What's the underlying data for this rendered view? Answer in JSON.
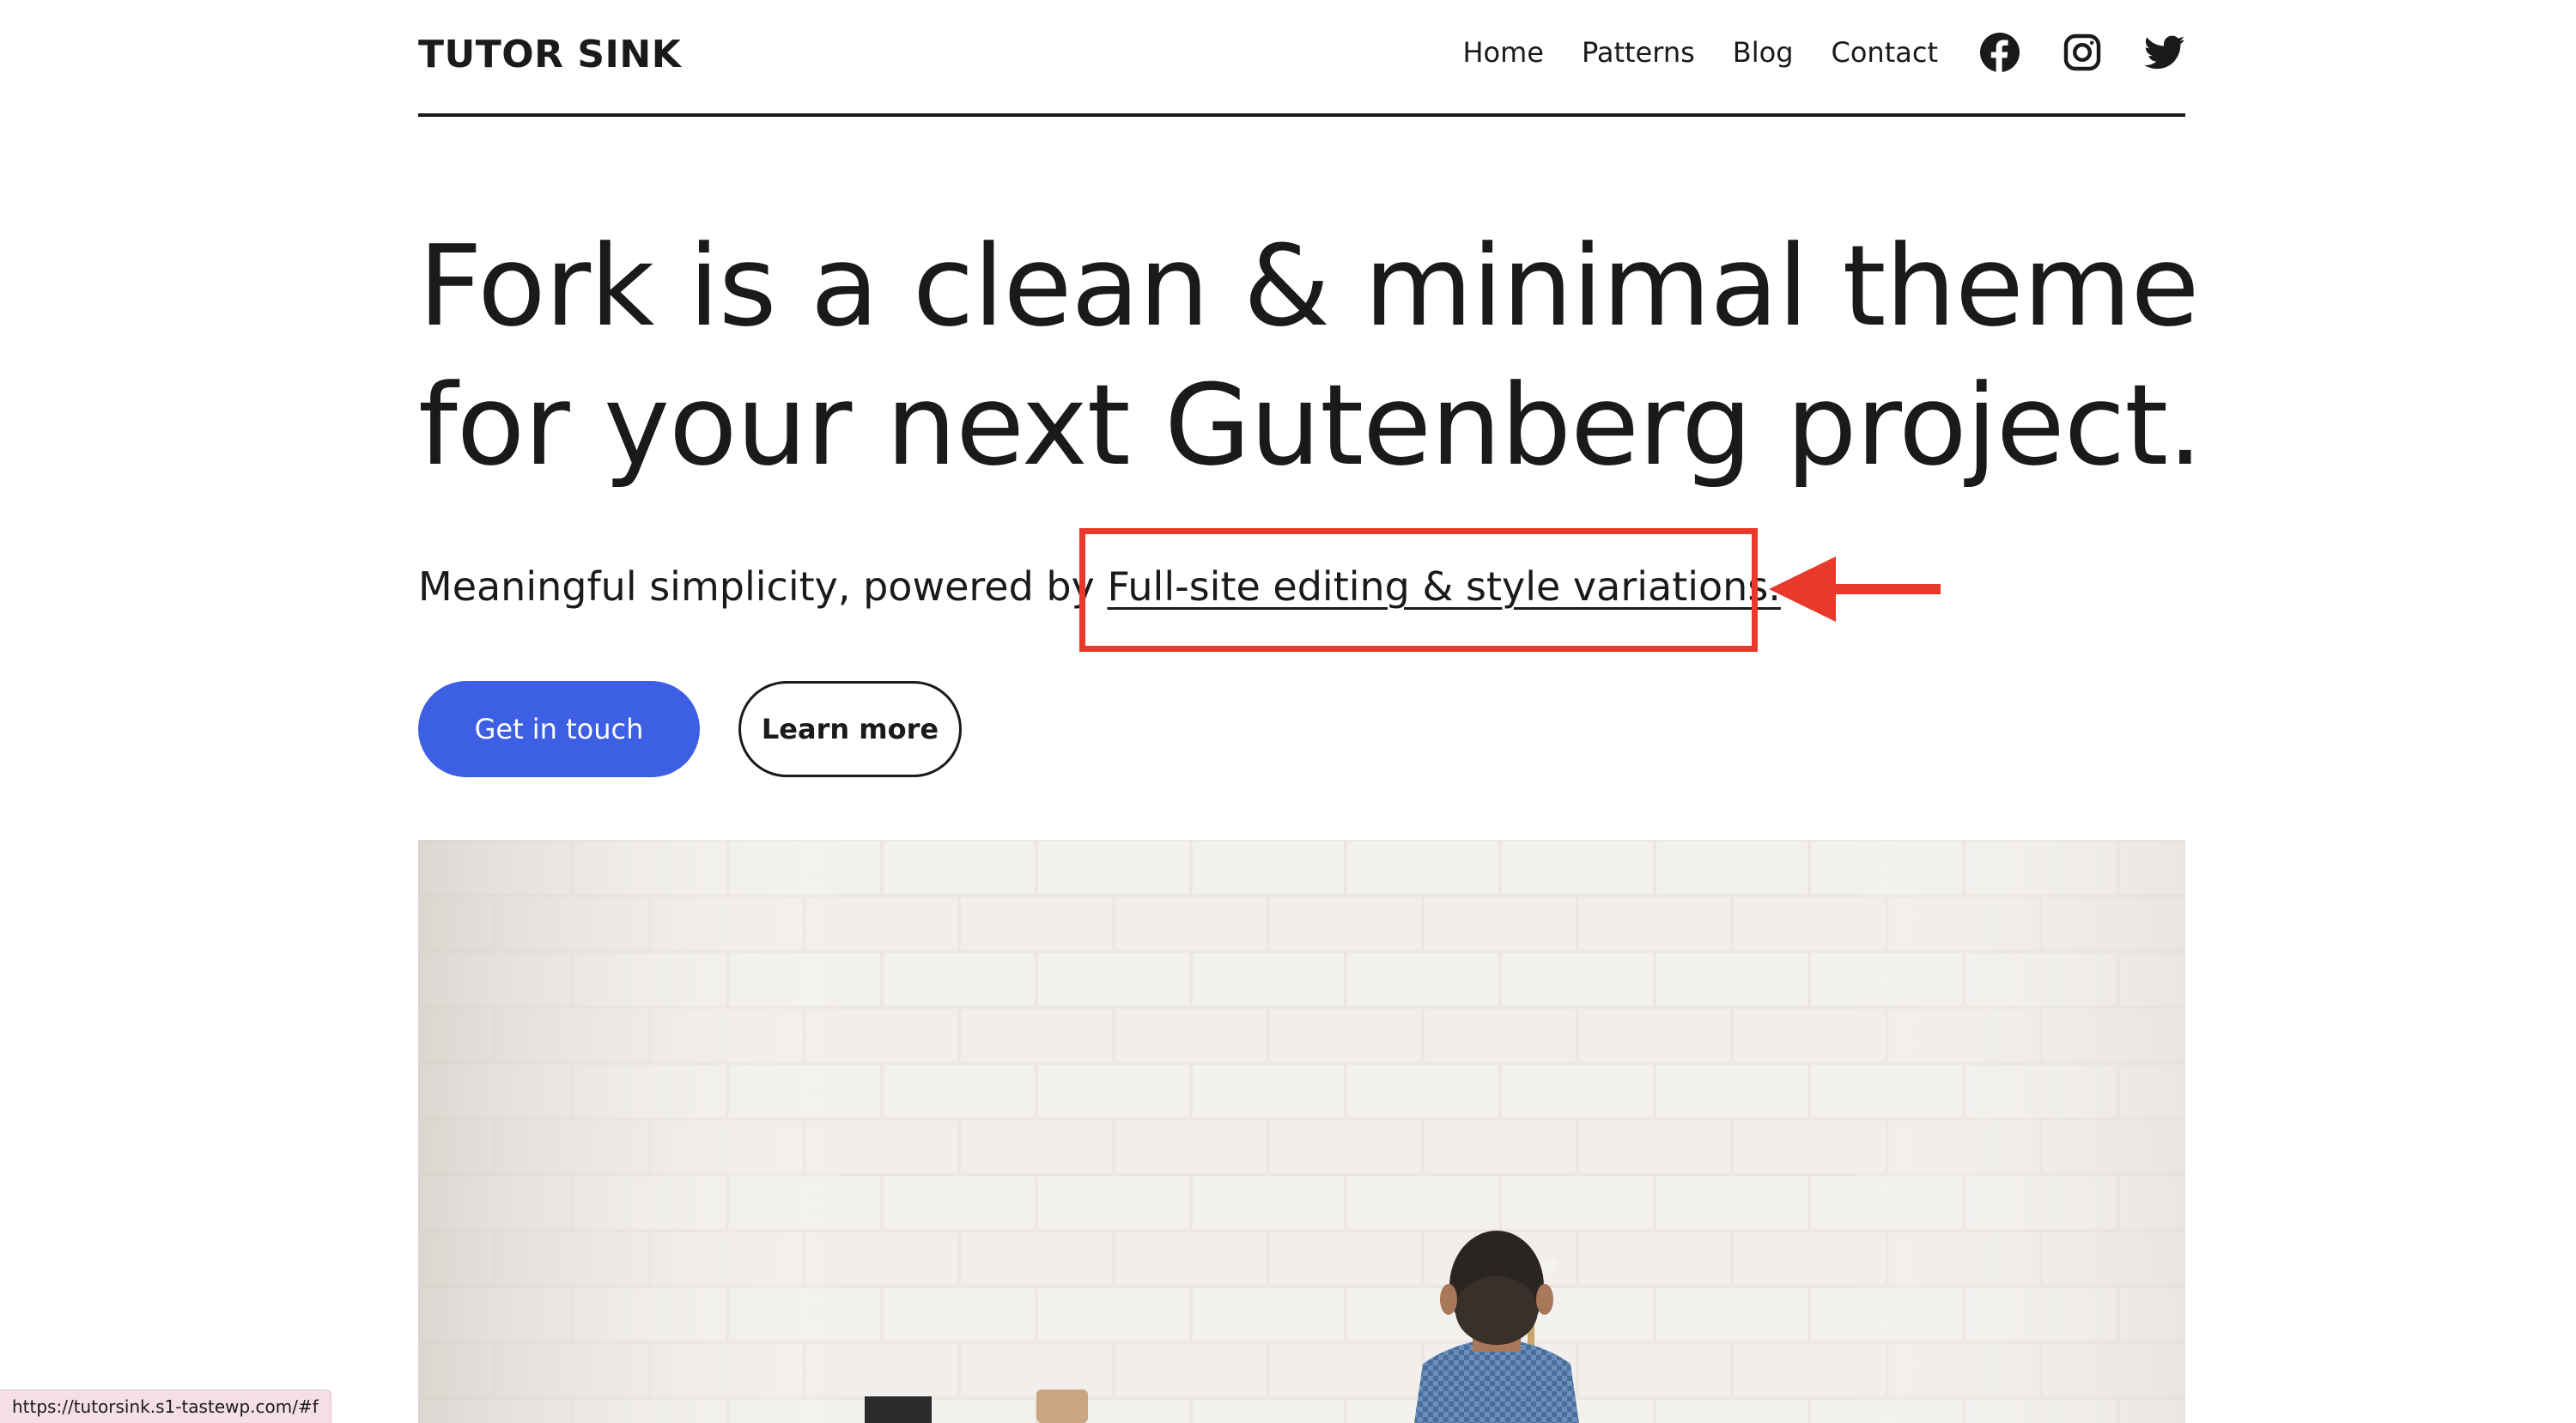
{
  "header": {
    "site_title": "TUTOR SINK",
    "nav": [
      {
        "label": "Home"
      },
      {
        "label": "Patterns"
      },
      {
        "label": "Blog"
      },
      {
        "label": "Contact"
      }
    ],
    "social_icons": [
      "facebook-icon",
      "instagram-icon",
      "twitter-icon"
    ]
  },
  "hero": {
    "title": "Fork is a clean & minimal theme for your next Gutenberg project.",
    "subtitle_prefix": "Meaningful simplicity, powered by",
    "subtitle_link": "Full-site editing & style variations.",
    "buttons": {
      "primary": "Get in touch",
      "secondary": "Learn more"
    }
  },
  "status_bar": {
    "url": "https://tutorsink.s1-tastewp.com/#f"
  },
  "colors": {
    "primary_button": "#3d5fe3",
    "annotation": "#e8392a",
    "text": "#1a1a1a"
  }
}
